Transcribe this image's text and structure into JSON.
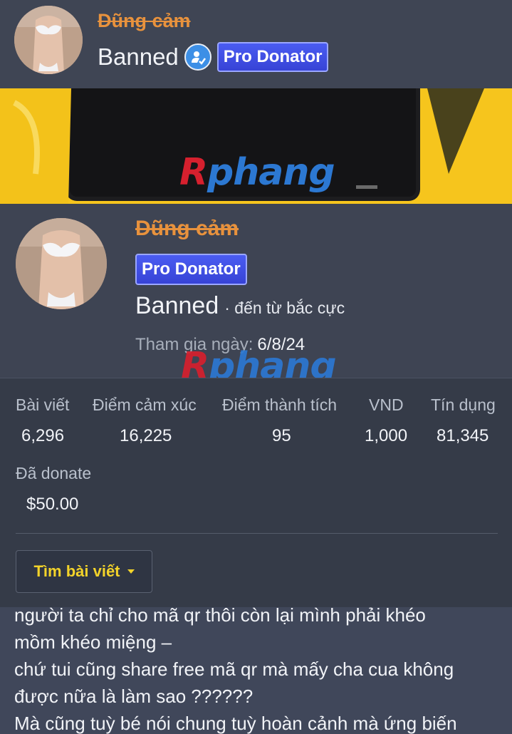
{
  "post_header": {
    "username": "Dũng cảm",
    "title": "Banned",
    "badge": "Pro Donator",
    "verified_icon": "verified-user-icon"
  },
  "popup": {
    "banner_watermark": {
      "r": "R",
      "rest": "phang"
    },
    "username": "Dũng cảm",
    "badge": "Pro Donator",
    "title": "Banned",
    "location": "· đến từ bắc cực",
    "joined_label": "Tham gia ngày:",
    "joined_value": "6/8/24",
    "watermark": {
      "r": "R",
      "rest": "phang"
    },
    "stats": [
      {
        "label": "Bài viết",
        "value": "6,296"
      },
      {
        "label": "Điểm cảm xúc",
        "value": "16,225"
      },
      {
        "label": "Điểm thành tích",
        "value": "95"
      },
      {
        "label": "VND",
        "value": "1,000"
      },
      {
        "label": "Tín dụng",
        "value": "81,345"
      }
    ],
    "donated": {
      "label": "Đã donate",
      "value": "$50.00"
    },
    "find_posts_label": "Tìm bài viết"
  },
  "post_body": {
    "lines": [
      "người ta chỉ cho mã qr thôi còn lại mình phải khéo",
      "mồm khéo miệng –",
      "chứ tui cũng share free mã qr mà mấy cha cua không",
      "được nữa là làm sao ??????",
      "Mà cũng tuỳ bé nói chung tuỳ hoàn cảnh mà ứng biến"
    ]
  },
  "colors": {
    "username": "#e8923d",
    "badge_bg": "#3a47dc",
    "accent_yellow": "#f3d32a",
    "background": "#3f4554"
  }
}
